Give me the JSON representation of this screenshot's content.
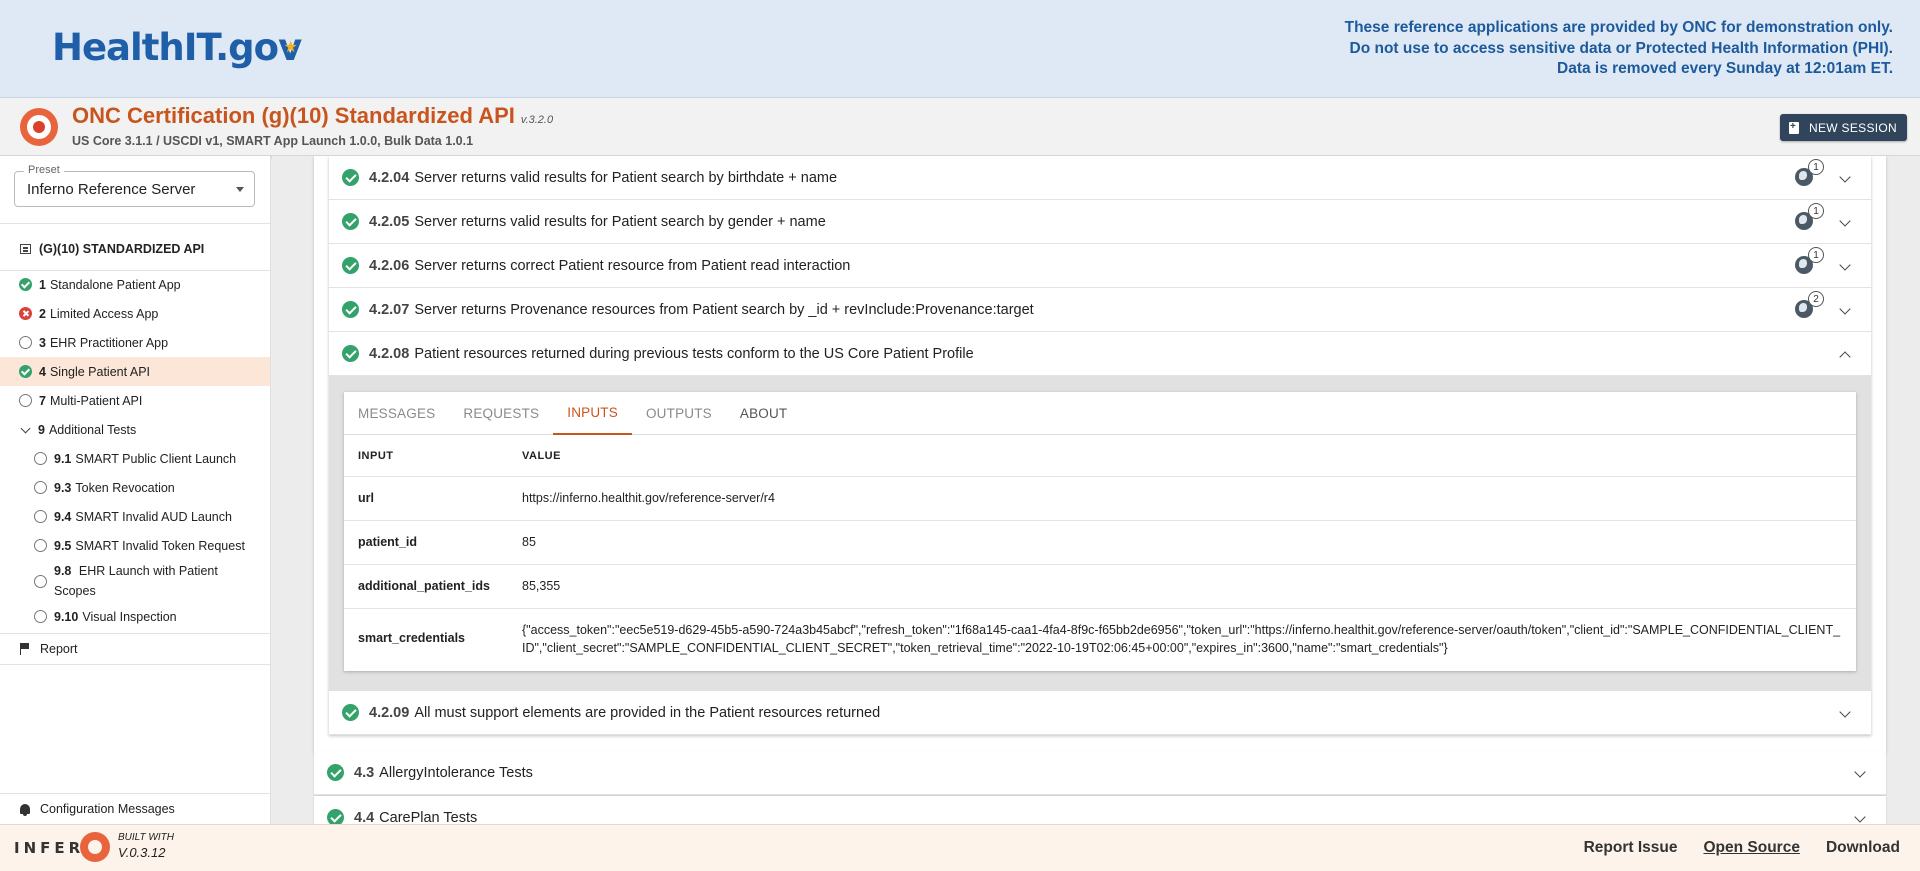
{
  "banner": {
    "brand": "HealthIT.gov",
    "notice_lines": [
      "These reference applications are provided by ONC for demonstration only.",
      "Do not use to access sensitive data or Protected Health Information (PHI).",
      "Data is removed every Sunday at 12:01am ET."
    ]
  },
  "header": {
    "title": "ONC Certification (g)(10) Standardized API",
    "version": "v.3.2.0",
    "subtitle": "US Core 3.1.1 / USCDI v1, SMART App Launch 1.0.0, Bulk Data 1.0.1",
    "new_session": "NEW SESSION"
  },
  "sidebar": {
    "preset_label": "Preset",
    "preset_value": "Inferno Reference Server",
    "suite_title": "(G)(10) STANDARDIZED API",
    "items": [
      {
        "num": "1",
        "label": "Standalone Patient App",
        "status": "pass"
      },
      {
        "num": "2",
        "label": "Limited Access App",
        "status": "fail"
      },
      {
        "num": "3",
        "label": "EHR Practitioner App",
        "status": "pending"
      },
      {
        "num": "4",
        "label": "Single Patient API",
        "status": "pass",
        "active": true
      },
      {
        "num": "7",
        "label": "Multi-Patient API",
        "status": "pending"
      },
      {
        "num": "9",
        "label": "Additional Tests",
        "status": "expanded"
      }
    ],
    "subitems": [
      {
        "num": "9.1",
        "label": "SMART Public Client Launch"
      },
      {
        "num": "9.3",
        "label": "Token Revocation"
      },
      {
        "num": "9.4",
        "label": "SMART Invalid AUD Launch"
      },
      {
        "num": "9.5",
        "label": "SMART Invalid Token Request"
      },
      {
        "num": "9.8",
        "label": "EHR Launch with Patient",
        "label2": "Scopes"
      },
      {
        "num": "9.10",
        "label": "Visual Inspection"
      }
    ],
    "report": "Report",
    "config_messages": "Configuration Messages"
  },
  "tests": [
    {
      "num": "4.2.04",
      "label": "Server returns valid results for Patient search by birthdate + name",
      "requests": "1"
    },
    {
      "num": "4.2.05",
      "label": "Server returns valid results for Patient search by gender + name",
      "requests": "1"
    },
    {
      "num": "4.2.06",
      "label": "Server returns correct Patient resource from Patient read interaction",
      "requests": "1"
    },
    {
      "num": "4.2.07",
      "label": "Server returns Provenance resources from Patient search by _id + revInclude:Provenance:target",
      "requests": "2"
    },
    {
      "num": "4.2.08",
      "label": "Patient resources returned during previous tests conform to the US Core Patient Profile"
    },
    {
      "num": "4.2.09",
      "label": "All must support elements are provided in the Patient resources returned"
    }
  ],
  "detail": {
    "tabs": [
      "MESSAGES",
      "REQUESTS",
      "INPUTS",
      "OUTPUTS",
      "ABOUT"
    ],
    "active_tab": "INPUTS",
    "col_input": "INPUT",
    "col_value": "VALUE",
    "inputs": [
      {
        "name": "url",
        "value": "https://inferno.healthit.gov/reference-server/r4"
      },
      {
        "name": "patient_id",
        "value": "85"
      },
      {
        "name": "additional_patient_ids",
        "value": "85,355"
      },
      {
        "name": "smart_credentials",
        "value": "{\"access_token\":\"eec5e519-d629-45b5-a590-724a3b45abcf\",\"refresh_token\":\"1f68a145-caa1-4fa4-8f9c-f65bb2de6956\",\"token_url\":\"https://inferno.healthit.gov/reference-server/oauth/token\",\"client_id\":\"SAMPLE_CONFIDENTIAL_CLIENT_ID\",\"client_secret\":\"SAMPLE_CONFIDENTIAL_CLIENT_SECRET\",\"token_retrieval_time\":\"2022-10-19T02:06:45+00:00\",\"expires_in\":3600,\"name\":\"smart_credentials\"}"
      }
    ]
  },
  "groups": [
    {
      "num": "4.3",
      "label": "AllergyIntolerance Tests"
    },
    {
      "num": "4.4",
      "label": "CarePlan Tests"
    }
  ],
  "footer": {
    "logo": "INFERN",
    "built_with": "BUILT WITH",
    "version": "V.0.3.12",
    "links": [
      "Report Issue",
      "Open Source",
      "Download"
    ]
  }
}
